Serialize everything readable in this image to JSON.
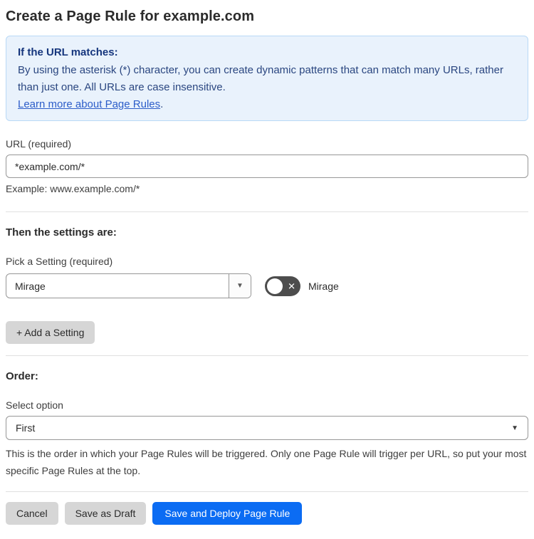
{
  "page": {
    "title": "Create a Page Rule for example.com"
  },
  "info_box": {
    "heading": "If the URL matches:",
    "body": "By using the asterisk (*) character, you can create dynamic patterns that can match many URLs, rather than just one. All URLs are case insensitive.",
    "link_label": "Learn more about Page Rules",
    "link_suffix": "."
  },
  "url_field": {
    "label": "URL (required)",
    "value": "*example.com/*",
    "example": "Example: www.example.com/*"
  },
  "settings_section": {
    "heading": "Then the settings are:",
    "picker_label": "Pick a Setting (required)",
    "picker_value": "Mirage",
    "picker_arrow_icon": "▼",
    "toggle_state": "off",
    "toggle_x_icon": "✕",
    "toggle_label": "Mirage",
    "add_setting_label": "+ Add a Setting"
  },
  "order_section": {
    "heading": "Order:",
    "select_label": "Select option",
    "select_value": "First",
    "select_arrow_icon": "▼",
    "help_text": "This is the order in which your Page Rules will be triggered. Only one Page Rule will trigger per URL, so put your most specific Page Rules at the top."
  },
  "footer": {
    "cancel_label": "Cancel",
    "save_draft_label": "Save as Draft",
    "save_deploy_label": "Save and Deploy Page Rule"
  },
  "colors": {
    "accent_blue": "#0b6cf3",
    "info_background": "#e9f2fc",
    "info_border": "#b9d9f6",
    "info_heading_text": "#16367d",
    "info_body_text": "#2a4680",
    "link_blue": "#2c5dc9",
    "gray_button": "#d6d6d6",
    "toggle_off_gray": "#4d4d4d",
    "divider": "#e0e0e0"
  }
}
